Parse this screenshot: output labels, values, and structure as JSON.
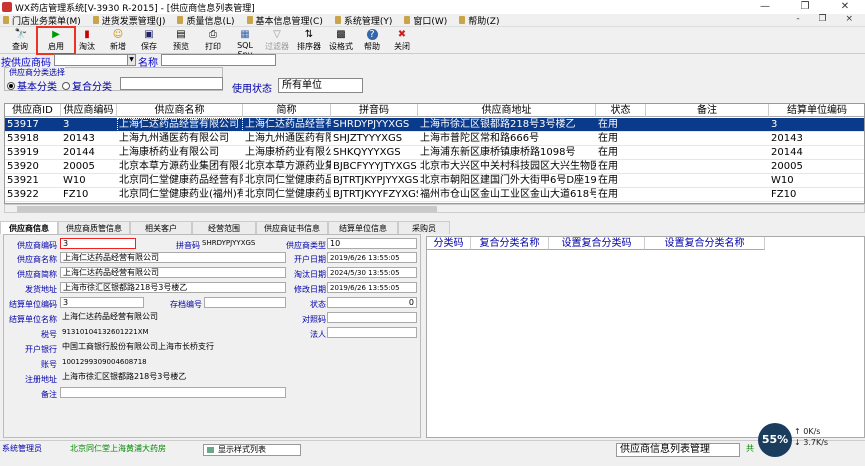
{
  "window": {
    "title": "WX药店管理系统[V-3930 R-2015] - [供应商信息列表管理]",
    "controls": [
      "—",
      "❐",
      "✕"
    ]
  },
  "menu": {
    "items": [
      "门店业务菜单(M)",
      "进货发票管理(J)",
      "质量信息(L)",
      "基本信息管理(C)",
      "系统管理(Y)",
      "窗口(W)",
      "帮助(Z)"
    ],
    "right": "- ❐ ×"
  },
  "toolbar": {
    "buttons": [
      {
        "label": "查询",
        "icon": "🔭"
      },
      {
        "label": "启用",
        "icon": "▶"
      },
      {
        "label": "淘汰",
        "icon": "▮"
      },
      {
        "label": "新增",
        "icon": "☺"
      },
      {
        "label": "保存",
        "icon": "▣"
      },
      {
        "label": "预览",
        "icon": "▤"
      },
      {
        "label": "打印",
        "icon": "⎙"
      },
      {
        "label": "SQL Spy",
        "icon": "▦"
      },
      {
        "label": "过滤器",
        "icon": "▽"
      },
      {
        "label": "排序器",
        "icon": "⇅"
      },
      {
        "label": "设格式",
        "icon": "▩"
      },
      {
        "label": "帮助",
        "icon": "?"
      },
      {
        "label": "关闭",
        "icon": "✖"
      }
    ]
  },
  "filter": {
    "supplier_label": "按供应商码",
    "supplier_value": "",
    "name_label": "名称",
    "name_value": "",
    "category_caption": "供应商分类选择",
    "basic_label": "基本分类",
    "composite_label": "复合分类",
    "status_label": "使用状态",
    "status_value": "所有单位"
  },
  "grid": {
    "columns": [
      "供应商ID",
      "供应商编码",
      "供应商名称",
      "简称",
      "拼音码",
      "供应商地址",
      "状态",
      "备注",
      "结算单位编码"
    ],
    "rows": [
      [
        "53917",
        "3",
        "上海仁达药品经营有限公司",
        "上海仁达药品经营有限公司",
        "SHRDYPJYYXGS",
        "上海市徐汇区银都路218号3号楼乙",
        "在用",
        "",
        "3"
      ],
      [
        "53918",
        "20143",
        "上海九州通医药有限公司",
        "上海九州通医药有限公司",
        "SHJZTYYYXGS",
        "上海市普陀区常和路666号",
        "在用",
        "",
        "20143"
      ],
      [
        "53919",
        "20144",
        "上海康桥药业有限公司",
        "上海康桥药业有限公司",
        "SHKQYYYXGS",
        "上海浦东新区康桥镇康桥路1098号",
        "在用",
        "",
        "20144"
      ],
      [
        "53920",
        "20005",
        "北京本草方源药业集团有限公司",
        "北京本草方源药业集团有限公司",
        "BJBCFYYYJTYXGS",
        "北京市大兴区中关村科技园区大兴生物医药",
        "在用",
        "",
        "20005"
      ],
      [
        "53921",
        "W10",
        "北京同仁堂健康药品经营有限公司",
        "北京同仁堂健康药品经营有限公司",
        "BJTRTJKYPJYYXGS",
        "北京市朝阳区建国门外大街甲6号D座19层",
        "在用",
        "",
        "W10"
      ],
      [
        "53922",
        "FZ10",
        "北京同仁堂健康药业(福州)有限公司",
        "北京同仁堂健康药业(福州)有限公司",
        "BJTRTJKYYFZYXGS",
        "福州市仓山区金山工业区金山大道618号",
        "在用",
        "",
        "FZ10"
      ]
    ],
    "selected_row": 0
  },
  "tabs": [
    "供应商信息",
    "供应商质管信息",
    "相关客户",
    "经营范围",
    "供应商证书信息",
    "结算单位信息",
    "采购员"
  ],
  "detail": {
    "code_label": "供应商编码",
    "code": "3",
    "pinyin_label": "拼音码",
    "pinyin": "SHRDYPJYYXGS",
    "type_label": "供应商类型",
    "type": "10",
    "name_label": "供应商名称",
    "name": "上海仁达药品经营有限公司",
    "open_label": "开户日期",
    "open_date": "2019/6/26 13:55:05",
    "short_label": "供应商简称",
    "short": "上海仁达药品经营有限公司",
    "retire_label": "淘汰日期",
    "retire_date": "2024/5/30 13:55:05",
    "ship_label": "发货地址",
    "ship": "上海市徐汇区银都路218号3号楼乙",
    "modify_label": "修改日期",
    "modify_date": "2019/6/26 13:55:05",
    "settle_code_label": "结算单位编码",
    "settle_code": "3",
    "stock_label": "存档编号",
    "stock": "",
    "status_label": "状态",
    "status": "0",
    "settle_name_label": "结算单位名称",
    "settle_name": "上海仁达药品经营有限公司",
    "counter_label": "对照码",
    "counter": "",
    "tax_label": "税号",
    "tax": "91310104132601221XM",
    "legal_label": "法人",
    "legal": "",
    "bank_label": "开户银行",
    "bank": "中国工商银行股份有限公司上海市长桥支行",
    "account_label": "账号",
    "account": "1001299309004608718",
    "reg_label": "注册地址",
    "reg": "上海市徐汇区银都路218号3号楼乙",
    "remark_label": "备注",
    "remark": ""
  },
  "right_grid": {
    "columns": [
      "分类码",
      "复合分类名称",
      "设置复合分类码",
      "设置复合分类名称"
    ]
  },
  "statusbar": {
    "left": "系统管理员",
    "store": "北京同仁堂上海黄浦大药房",
    "display": "显示样式列表",
    "window_name": "供应商信息列表管理",
    "right": "共"
  },
  "overlay": {
    "percent": "55%",
    "up": "0K/s",
    "down": "3.7K/s"
  }
}
